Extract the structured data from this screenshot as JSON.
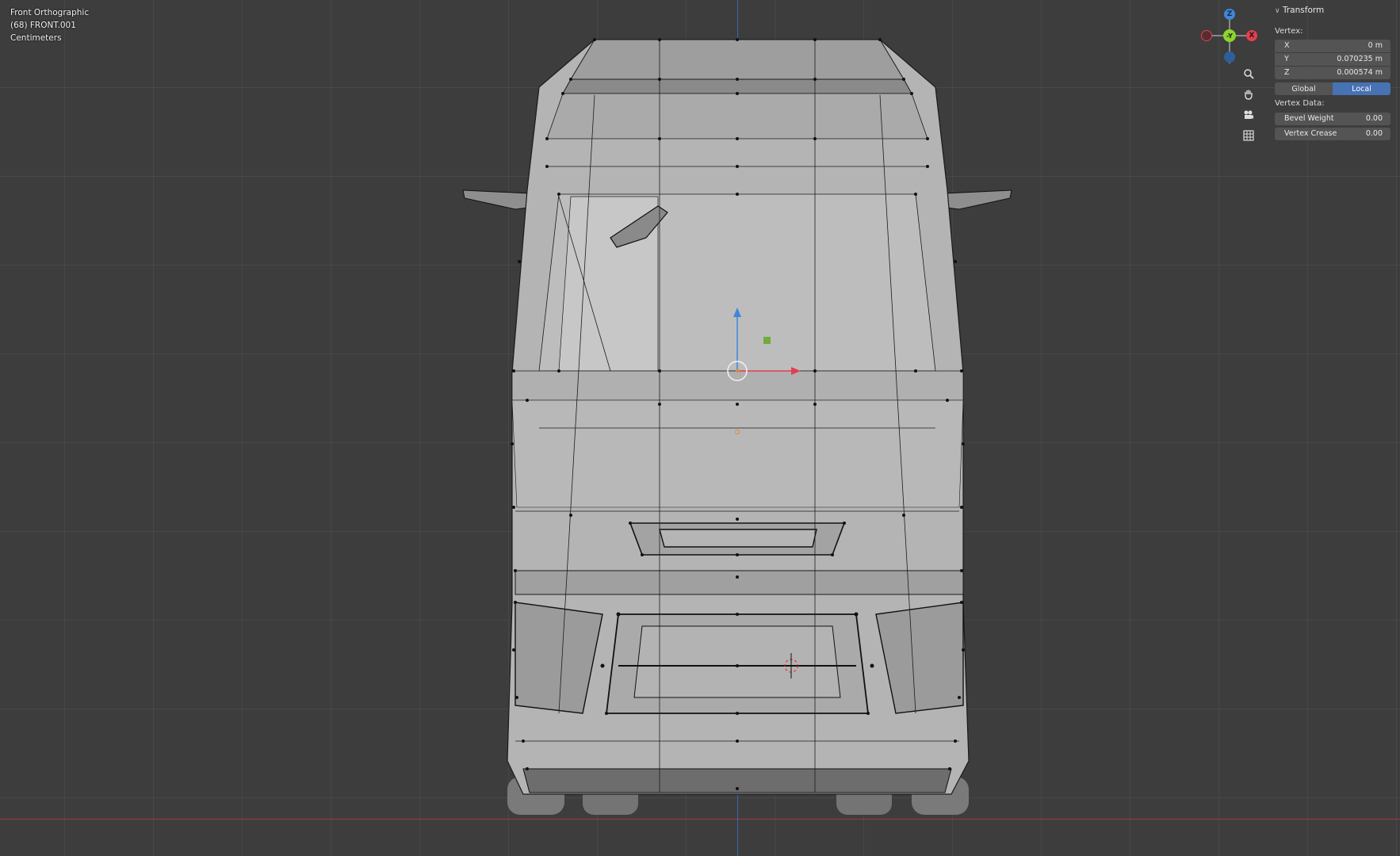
{
  "viewport": {
    "view_name": "Front Orthographic",
    "object_label": "(68) FRONT.001",
    "units": "Centimeters"
  },
  "gizmo": {
    "z": "Z",
    "y": "-Y",
    "x": "X",
    "colors": {
      "x": "#e0404f",
      "y": "#8dd52b",
      "z": "#3f86d8"
    }
  },
  "tools": [
    "zoom-icon",
    "pan-hand-icon",
    "camera-icon",
    "grid-icon"
  ],
  "panel": {
    "title": "Transform",
    "vertex_label": "Vertex:",
    "fields": [
      {
        "label": "X",
        "value": "0 m"
      },
      {
        "label": "Y",
        "value": "0.070235 m"
      },
      {
        "label": "Z",
        "value": "0.000574 m"
      }
    ],
    "space": {
      "global": "Global",
      "local": "Local",
      "active": "Local"
    },
    "vertex_data_label": "Vertex Data:",
    "vertex_data": [
      {
        "label": "Bevel Weight",
        "value": "0.00"
      },
      {
        "label": "Vertex Crease",
        "value": "0.00"
      }
    ]
  },
  "colors": {
    "accent": "#4772b3",
    "background": "#3d3d3d",
    "mesh": "#b9b9b9"
  }
}
